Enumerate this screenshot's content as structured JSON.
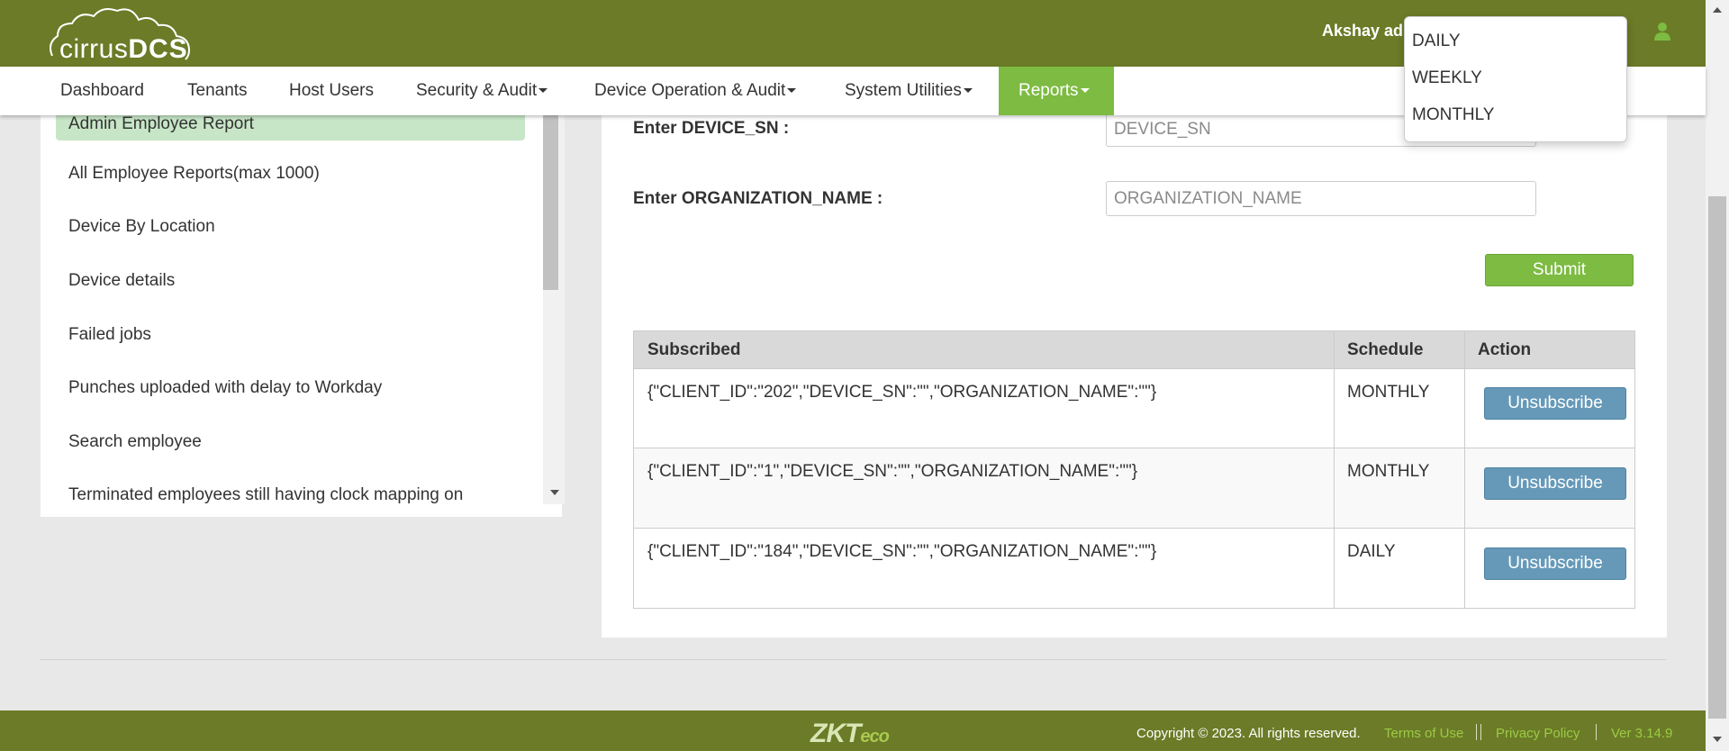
{
  "header": {
    "logo_text": "cirrus",
    "logo_brand": "DCS",
    "username": "Akshay adm"
  },
  "nav": {
    "items": [
      {
        "label": "Dashboard"
      },
      {
        "label": "Tenants"
      },
      {
        "label": "Host Users"
      },
      {
        "label": "Security & Audit"
      },
      {
        "label": "Device Operation & Audit"
      },
      {
        "label": "System Utilities"
      },
      {
        "label": "Reports"
      }
    ]
  },
  "report_list": {
    "items": [
      "Admin Employee Report",
      "All Employee Reports(max 1000)",
      "Device By Location",
      "Device details",
      "Failed jobs",
      "Punches uploaded with delay to Workday",
      "Search employee",
      "Terminated employees still having clock mapping on"
    ],
    "selected": "Admin Employee Report"
  },
  "form": {
    "device_sn_label": "Enter DEVICE_SN :",
    "device_sn_placeholder": "DEVICE_SN",
    "org_name_label": "Enter ORGANIZATION_NAME :",
    "org_name_placeholder": "ORGANIZATION_NAME",
    "submit_label": "Submit"
  },
  "subscriptions": {
    "headers": [
      "Subscribed",
      "Schedule",
      "Action"
    ],
    "rows": [
      {
        "subscribed": "{\"CLIENT_ID\":\"202\",\"DEVICE_SN\":\"\",\"ORGANIZATION_NAME\":\"\"}",
        "schedule": "MONTHLY",
        "action": "Unsubscribe"
      },
      {
        "subscribed": "{\"CLIENT_ID\":\"1\",\"DEVICE_SN\":\"\",\"ORGANIZATION_NAME\":\"\"}",
        "schedule": "MONTHLY",
        "action": "Unsubscribe"
      },
      {
        "subscribed": "{\"CLIENT_ID\":\"184\",\"DEVICE_SN\":\"\",\"ORGANIZATION_NAME\":\"\"}",
        "schedule": "DAILY",
        "action": "Unsubscribe"
      }
    ]
  },
  "schedule_dropdown": {
    "options": [
      "DAILY",
      "WEEKLY",
      "MONTHLY"
    ]
  },
  "footer": {
    "brand_zk": "ZKT",
    "brand_eco": "eco",
    "copyright": "Copyright © 2023. All rights reserved.",
    "terms": "Terms of Use",
    "privacy": "Privacy Policy",
    "version": "Ver 3.14.9"
  },
  "colors": {
    "header_bg": "#6b7b27",
    "accent_green": "#7dbb42",
    "selected_item_bg": "#c7e6c7",
    "unsubscribe_bg": "#6699b8",
    "footer_link": "#9ccb45"
  },
  "icons": [
    "user-icon",
    "caret-down-icon",
    "scroll-arrow-icon"
  ]
}
